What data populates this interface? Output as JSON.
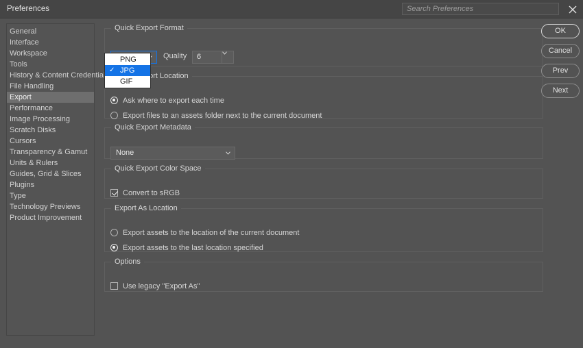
{
  "window": {
    "title": "Preferences",
    "close_icon": "close-icon"
  },
  "search": {
    "placeholder": "Search Preferences",
    "value": ""
  },
  "sidebar": {
    "items": [
      {
        "label": "General",
        "selected": false
      },
      {
        "label": "Interface",
        "selected": false
      },
      {
        "label": "Workspace",
        "selected": false
      },
      {
        "label": "Tools",
        "selected": false
      },
      {
        "label": "History & Content Credentials",
        "selected": false
      },
      {
        "label": "File Handling",
        "selected": false
      },
      {
        "label": "Export",
        "selected": true
      },
      {
        "label": "Performance",
        "selected": false
      },
      {
        "label": "Image Processing",
        "selected": false
      },
      {
        "label": "Scratch Disks",
        "selected": false
      },
      {
        "label": "Cursors",
        "selected": false
      },
      {
        "label": "Transparency & Gamut",
        "selected": false
      },
      {
        "label": "Units & Rulers",
        "selected": false
      },
      {
        "label": "Guides, Grid & Slices",
        "selected": false
      },
      {
        "label": "Plugins",
        "selected": false
      },
      {
        "label": "Type",
        "selected": false
      },
      {
        "label": "Technology Previews",
        "selected": false
      },
      {
        "label": "Product Improvement",
        "selected": false
      }
    ]
  },
  "groups": {
    "quick_export_format": {
      "title": "Quick Export Format",
      "format_select": {
        "value": "JPG",
        "open": true,
        "options": [
          {
            "label": "PNG",
            "selected": false
          },
          {
            "label": "JPG",
            "selected": true
          },
          {
            "label": "GIF",
            "selected": false
          }
        ],
        "check_glyph": "✓"
      },
      "quality_label": "Quality",
      "quality_value": "6"
    },
    "quick_export_location": {
      "title": "Quick Export Location",
      "options": [
        {
          "label": "Ask where to export each time",
          "selected": true
        },
        {
          "label": "Export files to an assets folder next to the current document",
          "selected": false
        }
      ]
    },
    "quick_export_metadata": {
      "title": "Quick Export Metadata",
      "metadata_select": {
        "value": "None"
      }
    },
    "quick_export_color_space": {
      "title": "Quick Export Color Space",
      "convert_srgb": {
        "label": "Convert to sRGB",
        "checked": true
      }
    },
    "export_as_location": {
      "title": "Export As Location",
      "options": [
        {
          "label": "Export assets to the location of the current document",
          "selected": false
        },
        {
          "label": "Export assets to the last location specified",
          "selected": true
        }
      ]
    },
    "options": {
      "title": "Options",
      "use_legacy": {
        "label": "Use legacy \"Export As\"",
        "checked": false
      }
    }
  },
  "buttons": [
    {
      "label": "OK",
      "default": true
    },
    {
      "label": "Cancel",
      "default": false
    },
    {
      "label": "Prev",
      "default": false
    },
    {
      "label": "Next",
      "default": false
    }
  ],
  "colors": {
    "window_bg": "#535353",
    "titlebar_bg": "#454545",
    "panel_bg": "#545454",
    "accent_blue": "#1473e6",
    "selected_item_bg": "#6e6e6e",
    "text": "#d4d4d4"
  }
}
